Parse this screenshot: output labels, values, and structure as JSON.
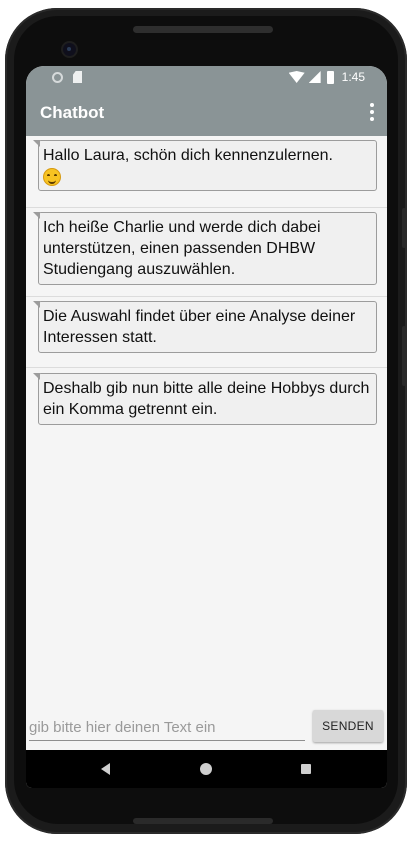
{
  "status_bar": {
    "time": "1:45",
    "icons": [
      "circle-icon",
      "sd-card-icon",
      "wifi-icon",
      "signal-icon",
      "battery-icon"
    ]
  },
  "app_bar": {
    "title": "Chatbot",
    "overflow_icon": "more-vert-icon"
  },
  "messages": [
    {
      "text": "Hallo Laura, schön dich kennenzulernen.",
      "emoji": "smiling-face-icon"
    },
    {
      "text": "Ich heiße Charlie und werde dich dabei unterstützen, einen passenden DHBW Studiengang auszuwählen."
    },
    {
      "text": "Die Auswahl findet über eine Analyse deiner Interessen statt."
    },
    {
      "text": "Deshalb gib nun bitte alle deine Hobbys durch ein Komma getrennt ein."
    }
  ],
  "input": {
    "placeholder": "gib bitte hier deinen Text ein",
    "value": ""
  },
  "send_button": {
    "label": "SENDEN"
  },
  "nav_bar": {
    "icons": [
      "back-icon",
      "home-icon",
      "recent-apps-icon"
    ]
  },
  "colors": {
    "app_bar": "#8a9496",
    "background": "#f5f5f5",
    "bubble": "#f0f0f0",
    "bubble_border": "#9c9c9c"
  }
}
